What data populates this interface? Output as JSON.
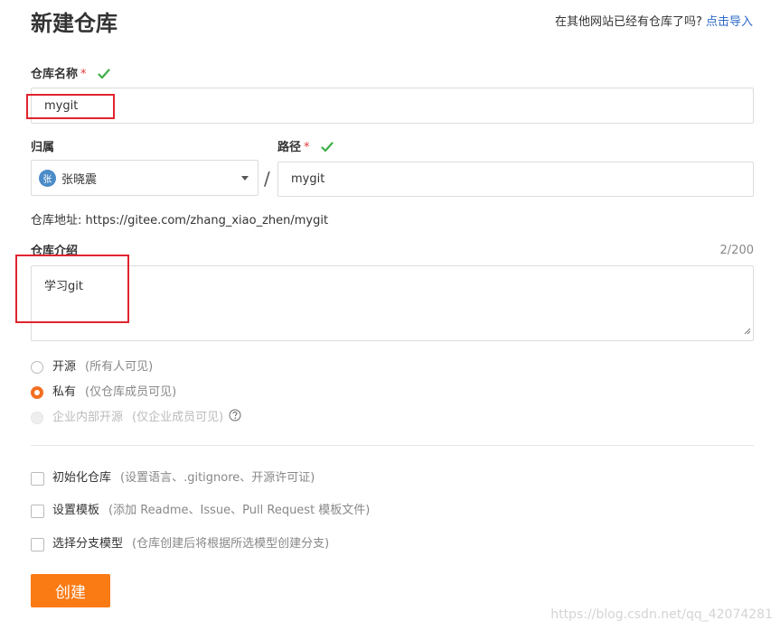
{
  "header": {
    "title": "新建仓库",
    "import_prompt": "在其他网站已经有仓库了吗?",
    "import_link": "点击导入"
  },
  "repo_name": {
    "label": "仓库名称",
    "required_mark": "*",
    "value": "mygit"
  },
  "owner": {
    "label": "归属",
    "avatar_text": "张",
    "value": "张晓震"
  },
  "path": {
    "separator": "/",
    "label": "路径",
    "required_mark": "*",
    "value": "mygit"
  },
  "address": {
    "text": "仓库地址: https://gitee.com/zhang_xiao_zhen/mygit"
  },
  "description": {
    "label": "仓库介绍",
    "counter": "2/200",
    "value": "学习git"
  },
  "visibility": {
    "options": [
      {
        "label": "开源",
        "hint": "(所有人可见)",
        "checked": false,
        "disabled": false
      },
      {
        "label": "私有",
        "hint": "(仅仓库成员可见)",
        "checked": true,
        "disabled": false
      },
      {
        "label": "企业内部开源",
        "hint": "(仅企业成员可见)",
        "checked": false,
        "disabled": true
      }
    ]
  },
  "options": [
    {
      "label": "初始化仓库",
      "hint": "(设置语言、.gitignore、开源许可证)"
    },
    {
      "label": "设置模板",
      "hint": "(添加 Readme、Issue、Pull Request 模板文件)"
    },
    {
      "label": "选择分支模型",
      "hint": "(仓库创建后将根据所选模型创建分支)"
    }
  ],
  "create_button": "创建",
  "watermark": "https://blog.csdn.net/qq_42074281",
  "colors": {
    "accent": "#fa7a14",
    "success": "#3fae49",
    "required": "#e4393c",
    "link": "#2b68c7",
    "annotation": "#e0242f"
  }
}
